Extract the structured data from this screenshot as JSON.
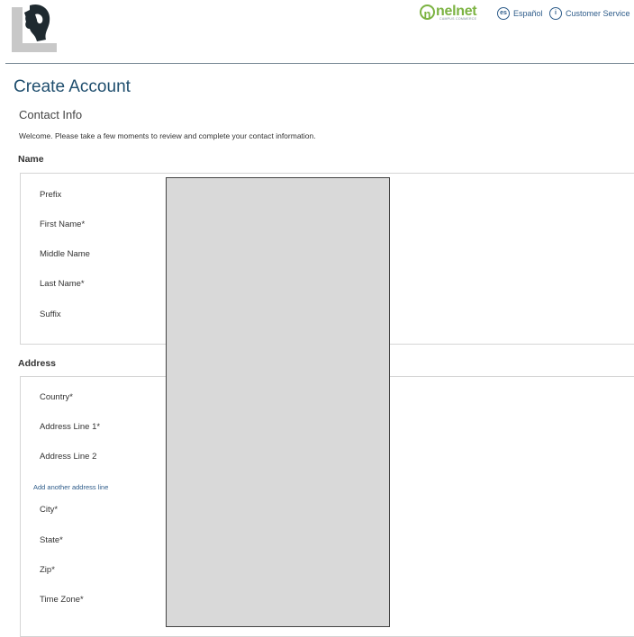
{
  "header": {
    "logo_icon": "university-seal-logo-icon",
    "partner_logo": "nelnet",
    "partner_logo_sub": "CAMPUS COMMERCE",
    "language_badge": "es",
    "language_label": "Español",
    "service_badge": "i",
    "service_label": "Customer Service"
  },
  "page": {
    "title": "Create Account",
    "section_title": "Contact Info",
    "welcome": "Welcome. Please take a few moments to review and complete your contact information."
  },
  "name_group": {
    "title": "Name",
    "fields": [
      "Prefix",
      "First Name*",
      "Middle Name",
      "Last Name*",
      "Suffix"
    ]
  },
  "address_group": {
    "title": "Address",
    "fields": [
      "Country*",
      "Address Line 1*",
      "Address Line 2",
      "City*",
      "State*",
      "Zip*",
      "Time Zone*"
    ],
    "add_line_link": "Add another address line"
  },
  "colors": {
    "accent": "#1f4e6e",
    "link": "#2e5c8a",
    "partner_green": "#7cb342",
    "redaction": "#d9d9d9"
  }
}
